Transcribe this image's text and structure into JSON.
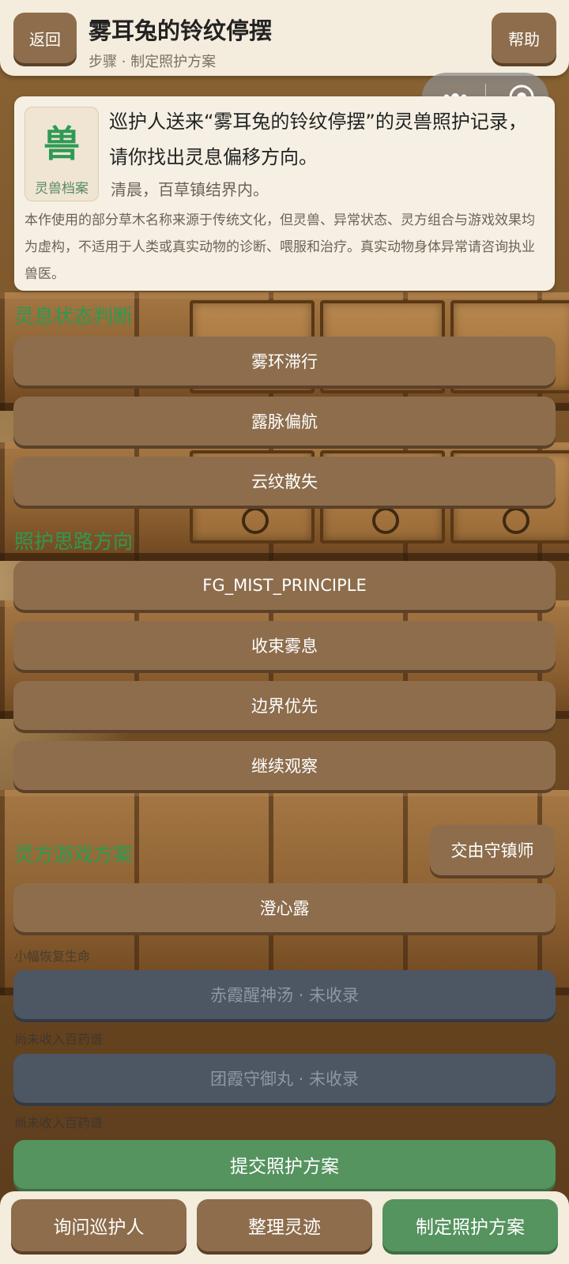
{
  "header": {
    "back_label": "返回",
    "title": "雾耳兔的铃纹停摆",
    "subtitle": "步骤 · 制定照护方案",
    "help_label": "帮助"
  },
  "card": {
    "badge_char": "兽",
    "badge_label": "灵兽档案",
    "lead": "巡护人送来“雾耳兔的铃纹停摆”的灵兽照护记录，请你找出灵息偏移方向。",
    "time_place": "清晨，百草镇结界内。",
    "disclaimer": "本作使用的部分草木名称来源于传统文化，但灵兽、异常状态、灵方组合与游戏效果均为虚构，不适用于人类或真实动物的诊断、喂服和治疗。真实动物身体异常请咨询执业兽医。"
  },
  "sections": {
    "state": {
      "label": "灵息状态判断",
      "options": [
        "雾环滞行",
        "露脉偏航",
        "云纹散失"
      ]
    },
    "direction": {
      "label": "照护思路方向",
      "options": [
        "FG_MIST_PRINCIPLE",
        "收束雾息",
        "边界优先",
        "继续观察"
      ]
    },
    "recipe": {
      "label": "灵方游戏方案",
      "handoff_label": "交由守镇师",
      "options": [
        {
          "label": "澄心露",
          "note": "小幅恢复生命",
          "locked": false
        },
        {
          "label": "赤霞醒神汤 · 未收录",
          "note": "尚未收入百药谱",
          "locked": true
        },
        {
          "label": "团霞守御丸 · 未收录",
          "note": "尚未收入百药谱",
          "locked": true
        }
      ]
    }
  },
  "submit_label": "提交照护方案",
  "tabs": [
    {
      "label": "询问巡护人",
      "active": false
    },
    {
      "label": "整理灵迹",
      "active": false
    },
    {
      "label": "制定照护方案",
      "active": true
    }
  ],
  "colors": {
    "brown_button": "#8d6d4c",
    "green_accent": "#55935f",
    "section_green": "#2d9a50",
    "locked_button": "#4d5663",
    "panel_bg": "#f4ecdc"
  },
  "icons": [
    "more-dots-icon",
    "capsule-close-icon"
  ]
}
